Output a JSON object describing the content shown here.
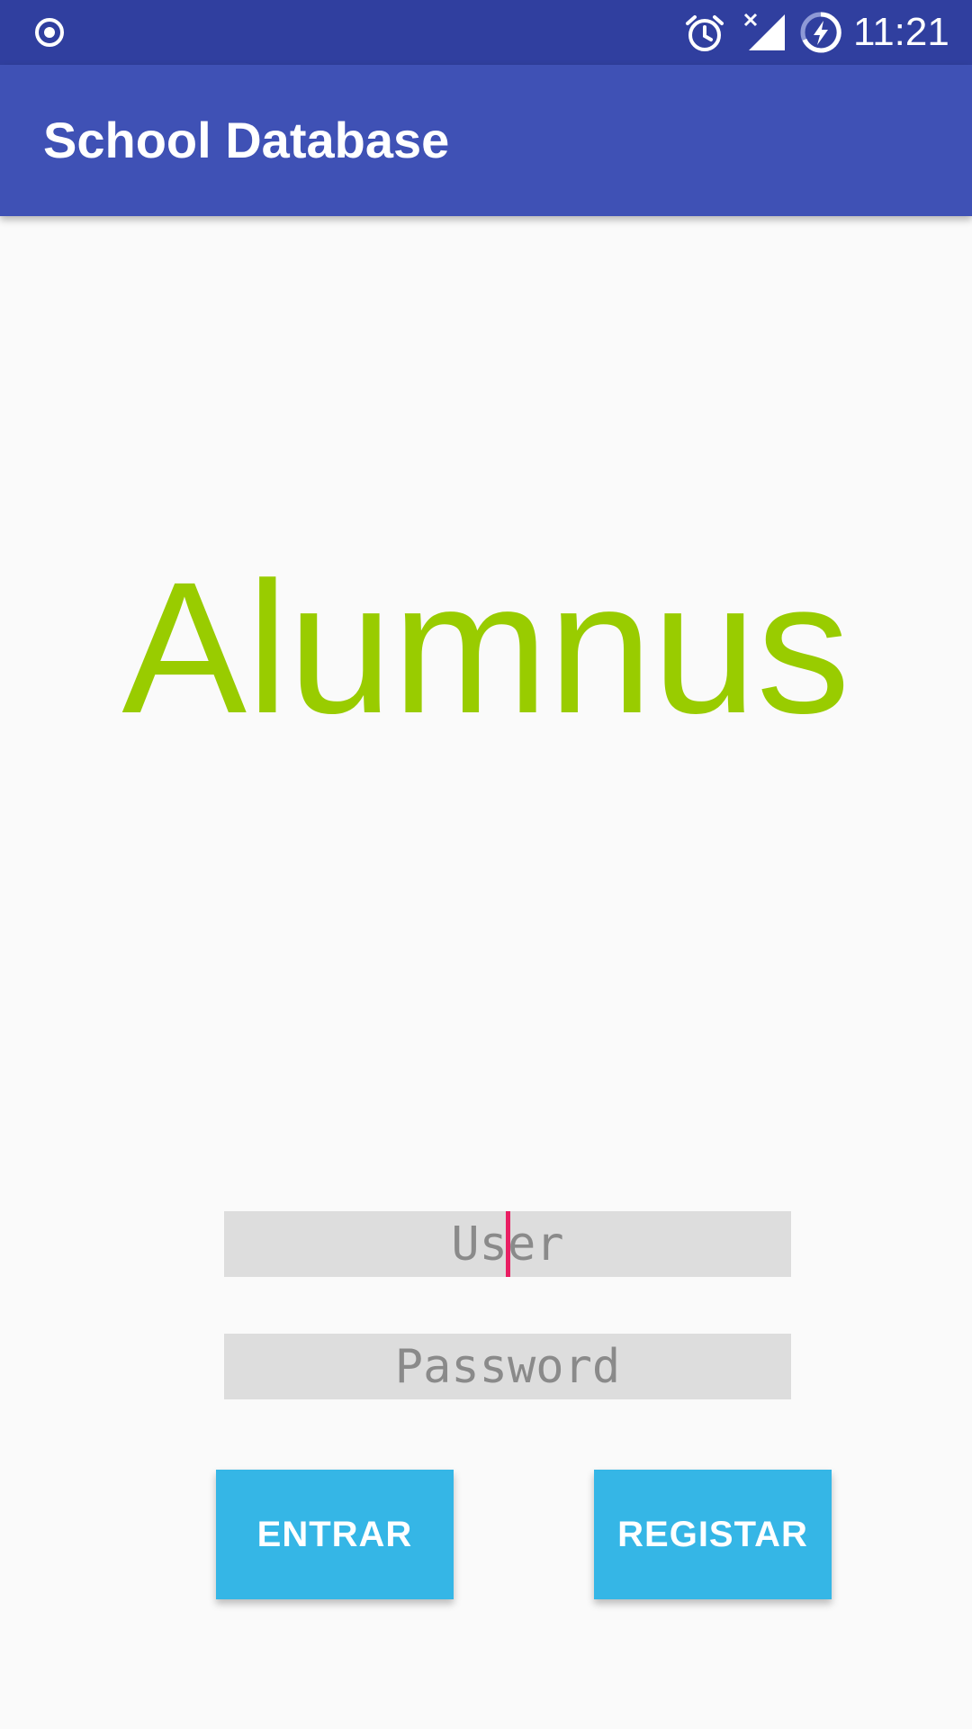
{
  "status_bar": {
    "time": "11:21",
    "icons": [
      "record-icon",
      "alarm-icon",
      "signal-no-data-icon",
      "battery-charging-icon"
    ]
  },
  "app_bar": {
    "title": "School Database"
  },
  "logo": {
    "text": "Alumnus",
    "color": "#99CC00"
  },
  "form": {
    "user": {
      "placeholder": "User",
      "value": ""
    },
    "password": {
      "placeholder": "Password",
      "value": ""
    }
  },
  "buttons": {
    "login_label": "ENTRAR",
    "register_label": "REGISTAR"
  },
  "colors": {
    "status_bar": "#303F9F",
    "app_bar": "#3F51B5",
    "button": "#35B6E6",
    "field_background": "#DDDDDD",
    "caret": "#E91E63",
    "background": "#FAFAFA"
  }
}
